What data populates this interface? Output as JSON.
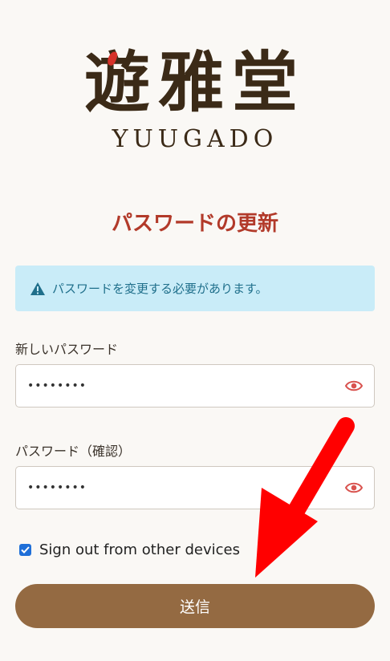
{
  "logo": {
    "kanji": "遊雅堂",
    "roman": "YUUGADO"
  },
  "page_title": "パスワードの更新",
  "alert": {
    "text": "パスワードを変更する必要があります。",
    "icon": "warning-icon",
    "color": "#1f6f8b"
  },
  "new_password": {
    "label": "新しいパスワード",
    "value": "••••••••",
    "icon": "eye-icon"
  },
  "confirm_password": {
    "label": "パスワード（確認）",
    "value": "••••••••",
    "icon": "eye-icon"
  },
  "sign_out_other": {
    "label": "Sign out from other devices",
    "checked": true
  },
  "submit": {
    "label": "送信",
    "color": "#946a42"
  },
  "colors": {
    "accent_red": "#b23a2a",
    "annotation_arrow": "#ff0000"
  }
}
